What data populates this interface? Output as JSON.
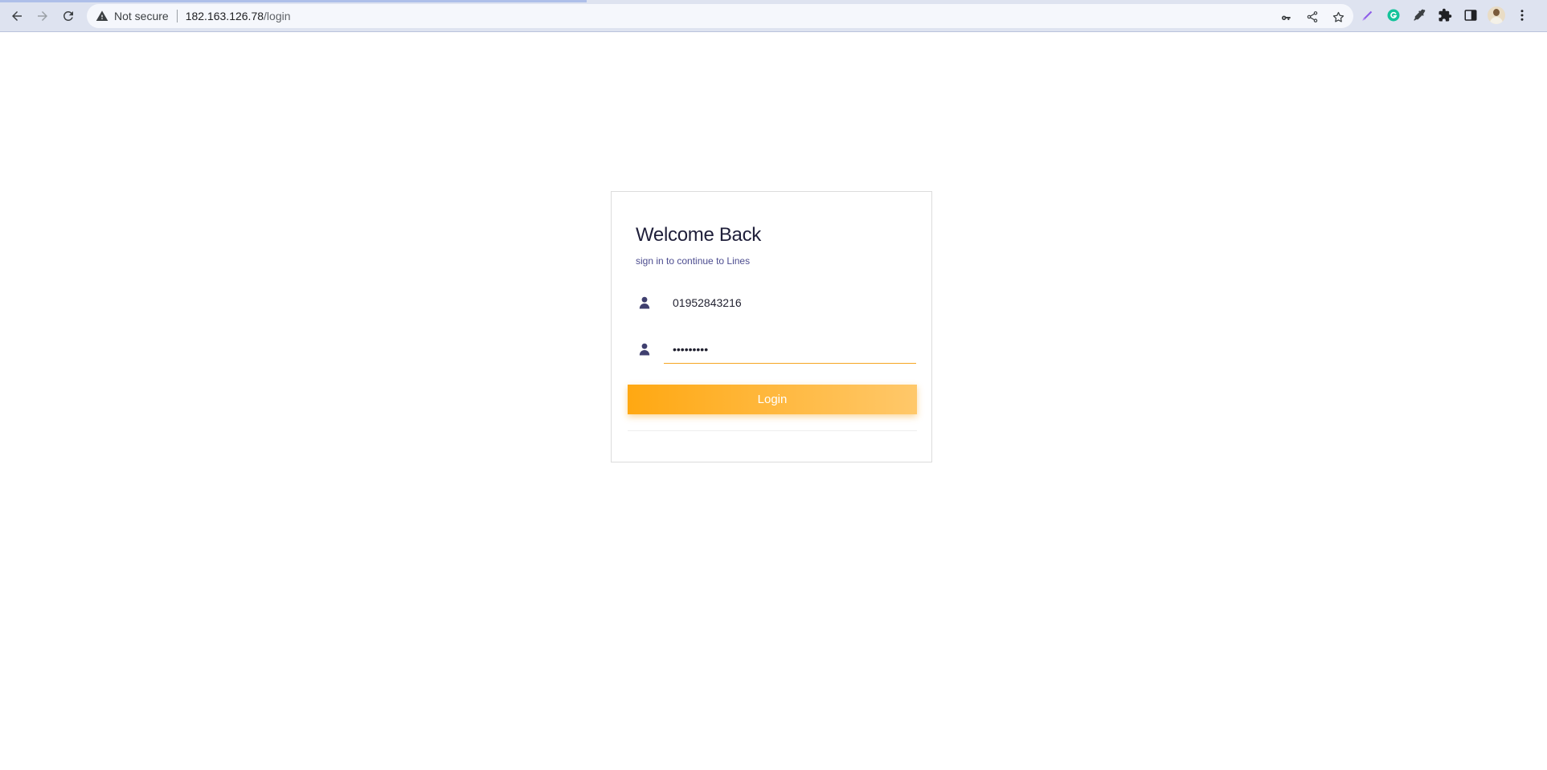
{
  "browser": {
    "security_label": "Not secure",
    "url_host": "182.163.126.78",
    "url_path": "/login",
    "icons": {
      "back": "back-arrow-icon",
      "forward": "forward-arrow-icon",
      "reload": "reload-icon",
      "warning": "warning-triangle-icon",
      "key": "key-icon",
      "share": "share-icon",
      "star": "bookmark-star-icon",
      "pen": "pen-extension-icon",
      "grammarly": "grammarly-extension-icon",
      "dropper": "eyedropper-extension-icon",
      "puzzle": "extensions-puzzle-icon",
      "sidepanel": "side-panel-icon",
      "avatar": "profile-avatar",
      "menu": "kebab-menu-icon"
    }
  },
  "login": {
    "title": "Welcome Back",
    "subtitle": "sign in to continue to Lines",
    "phone_value": "01952843216",
    "password_value": "•••••••••",
    "login_label": "Login",
    "colors": {
      "accent": "#f5a623",
      "button_start": "#ffa812",
      "button_end": "#ffc86a",
      "title": "#1f1f3a",
      "subtitle": "#4c4c8f",
      "icon": "#3f3f6f"
    }
  }
}
